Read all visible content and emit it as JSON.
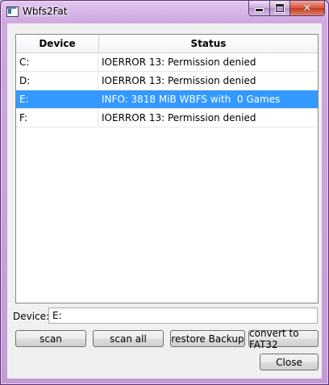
{
  "window": {
    "title": "Wbfs2Fat"
  },
  "table": {
    "headers": {
      "device": "Device",
      "status": "Status"
    },
    "rows": [
      {
        "device": "C:",
        "status": "IOERROR 13: Permission denied"
      },
      {
        "device": "D:",
        "status": "IOERROR 13: Permission denied"
      },
      {
        "device": "E:",
        "status": "INFO: 3818 MiB WBFS with  0 Games"
      },
      {
        "device": "F:",
        "status": "IOERROR 13: Permission denied"
      }
    ],
    "selected_row": 2
  },
  "device_field": {
    "label": "Device:",
    "value": "E:"
  },
  "buttons": {
    "scan": "scan",
    "scan_all": "scan all",
    "restore_backup": "restore Backup",
    "convert": "convert to FAT32",
    "close": "Close"
  },
  "colors": {
    "selection": "#3399ff",
    "frame": "#c9a6d8"
  },
  "icons": [
    "app-icon",
    "minimize-icon",
    "maximize-icon",
    "close-icon"
  ]
}
